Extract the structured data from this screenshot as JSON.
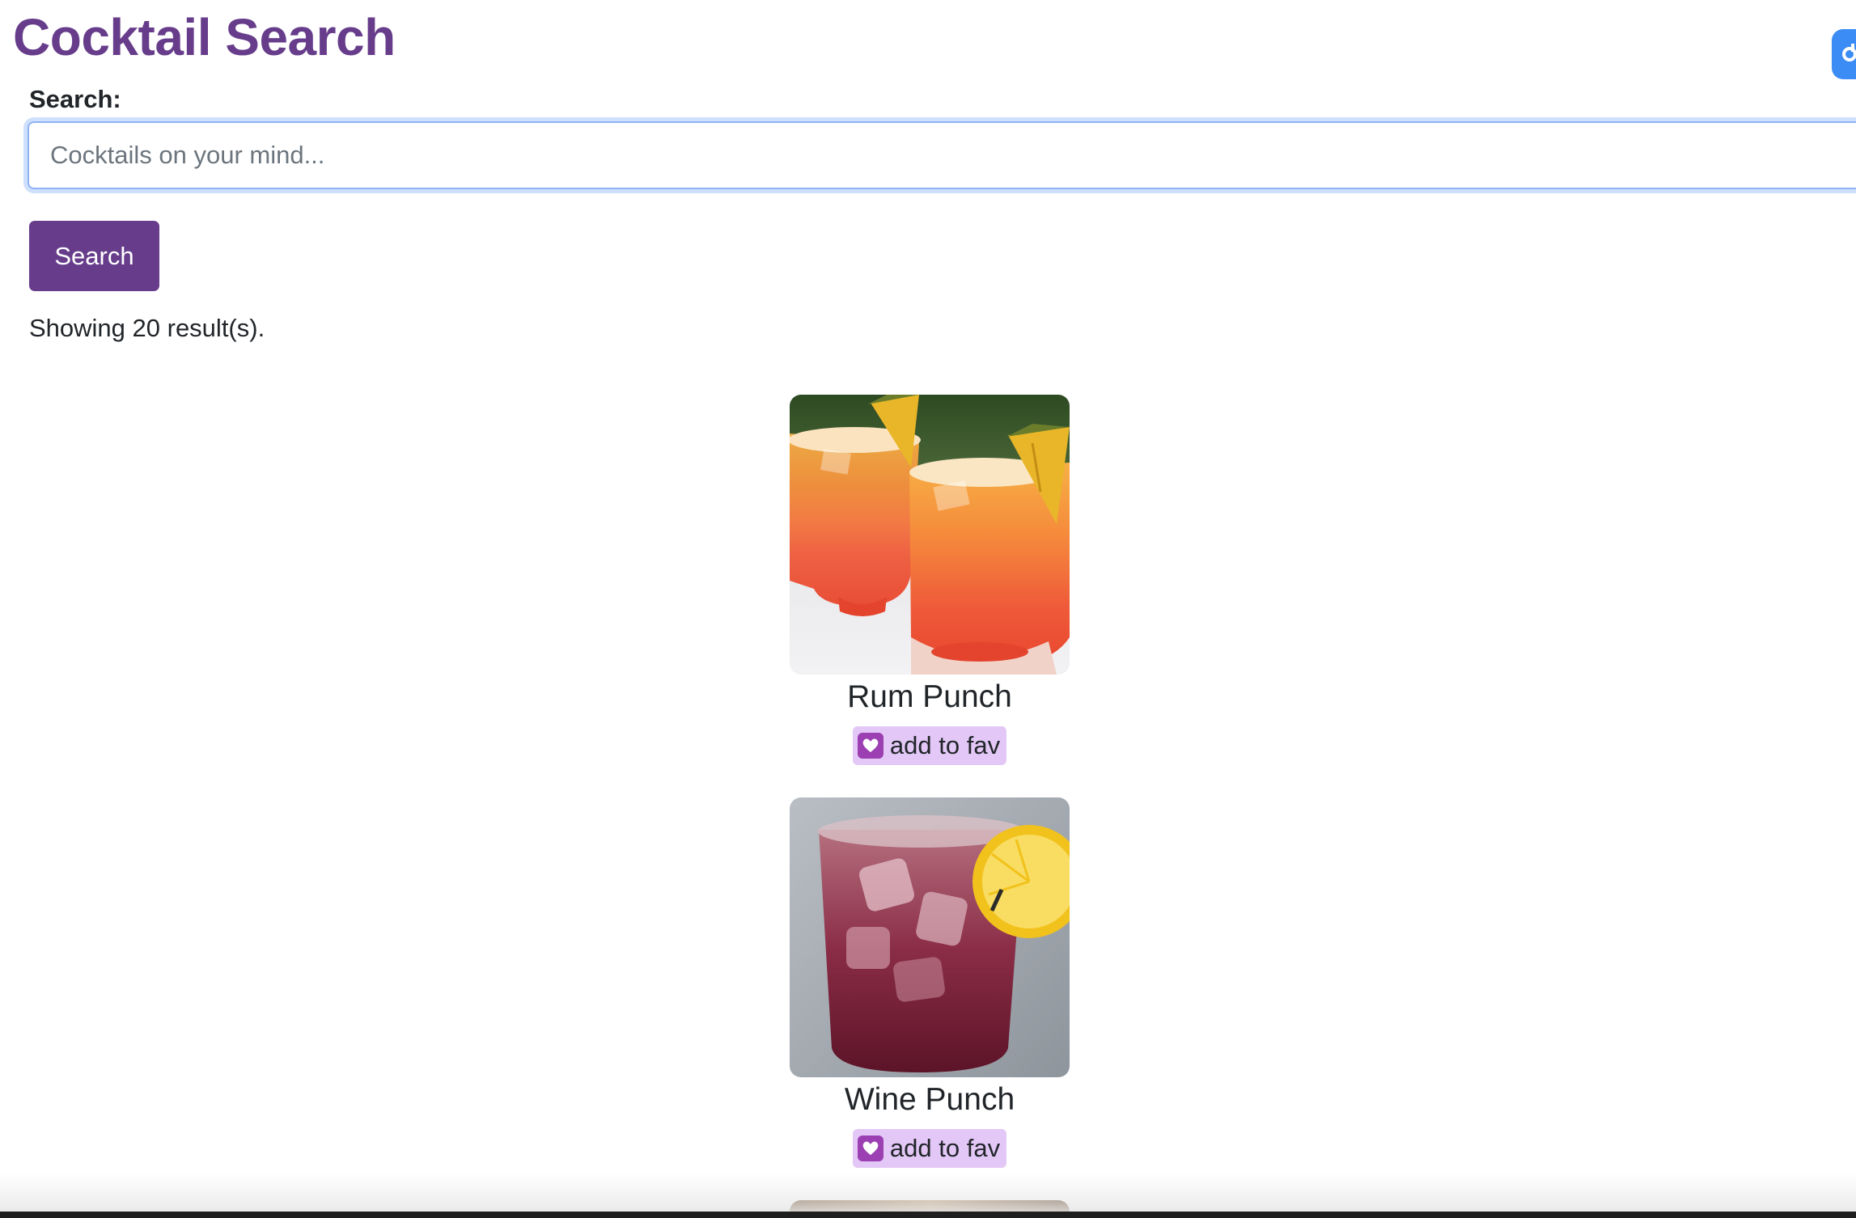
{
  "header": {
    "title": "Cocktail Search"
  },
  "search": {
    "label": "Search:",
    "placeholder": "Cocktails on your mind...",
    "value": "",
    "button_label": "Search"
  },
  "results": {
    "summary": "Showing 20 result(s).",
    "cards": [
      {
        "name": "Rum Punch",
        "fav_label": "add to fav",
        "image": "rum-punch-photo"
      },
      {
        "name": "Wine Punch",
        "fav_label": "add to fav",
        "image": "wine-punch-photo"
      }
    ]
  },
  "icons": {
    "fav": "heart-icon",
    "corner": "extension-icon"
  },
  "colors": {
    "brand": "#673d8b",
    "fav_bg": "#e3c8f7",
    "focus_ring": "#8fb2f6"
  }
}
